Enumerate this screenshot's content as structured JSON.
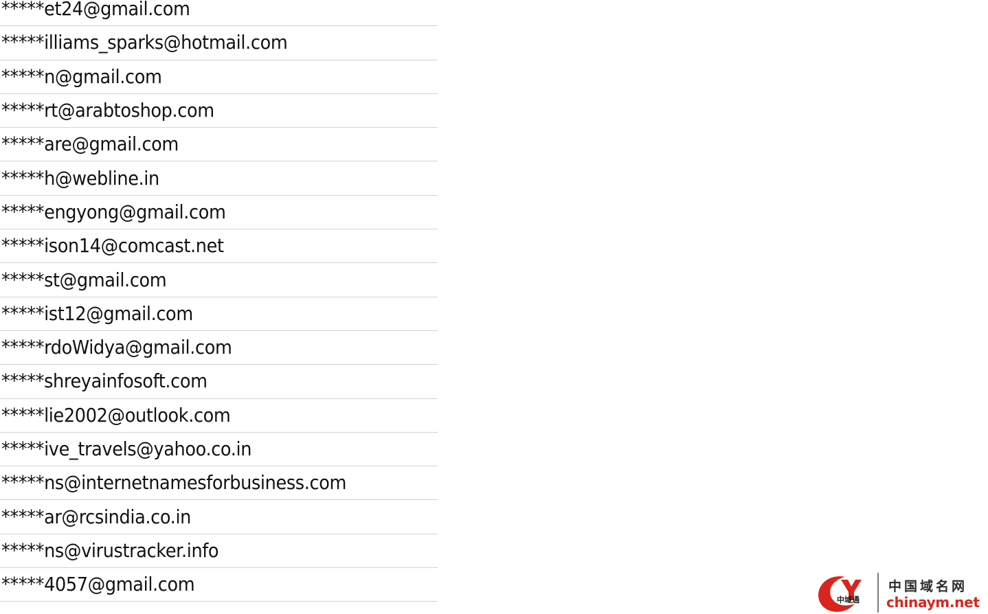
{
  "emails": [
    "*****et24@gmail.com",
    "*****illiams_sparks@hotmail.com",
    "*****n@gmail.com",
    "*****rt@arabtoshop.com",
    "*****are@gmail.com",
    "*****h@webline.in",
    "*****engyong@gmail.com",
    "*****ison14@comcast.net",
    "*****st@gmail.com",
    "*****ist12@gmail.com",
    "*****rdoWidya@gmail.com",
    "*****shreyainfosoft.com",
    "*****lie2002@outlook.com",
    "*****ive_travels@yahoo.co.in",
    "*****ns@internetnamesforbusiness.com",
    "*****ar@rcsindia.co.in",
    "*****ns@virustracker.info",
    "*****4057@gmail.com"
  ],
  "watermark": {
    "logo_label": "中域通",
    "cn_name": "中国域名网",
    "domain": "chinaym.net",
    "brand_color": "#d9251c"
  }
}
